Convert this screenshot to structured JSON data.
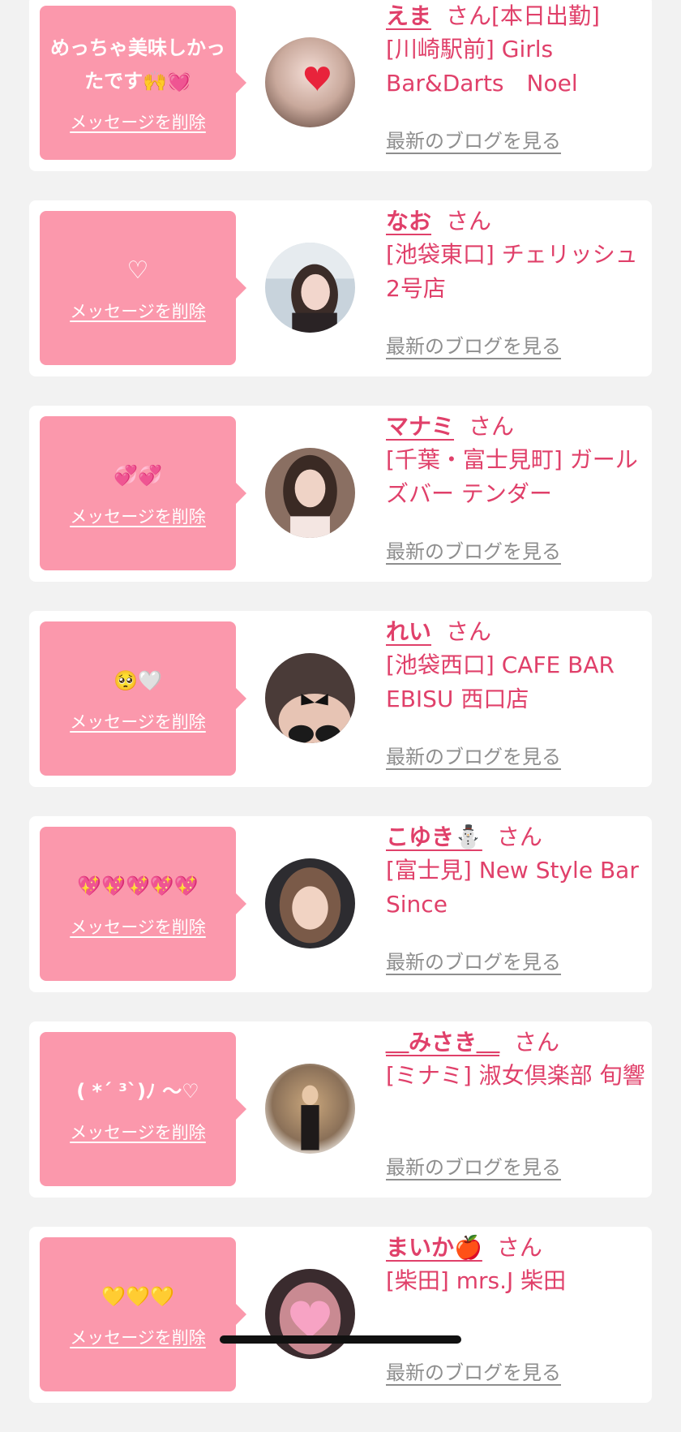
{
  "delete_label": "メッセージを削除",
  "blog_label": "最新のブログを見る",
  "san_label": "さん",
  "colors": {
    "background": "#f2f2f2",
    "bubble": "#fb98ac",
    "accent_text": "#e0406a",
    "link_gray": "#8e8e8e"
  },
  "cards": [
    {
      "message": "めっちゃ美味しかったです🙌💓",
      "name": "えま",
      "suffix": "さん[本日出勤]",
      "shop": "[川崎駅前] Girls Bar&Darts　Noel",
      "avatar_icon": "avatar-ema"
    },
    {
      "message": "♡",
      "name": "なお",
      "suffix": "さん",
      "shop": "[池袋東口] チェリッシュ2号店",
      "avatar_icon": "avatar-nao"
    },
    {
      "message": "💞💞",
      "name": "マナミ",
      "suffix": "さん",
      "shop": "[千葉・富士見町] ガールズバー テンダー",
      "avatar_icon": "avatar-manami"
    },
    {
      "message": "🥺🤍",
      "name": "れい",
      "suffix": "さん",
      "shop": "[池袋西口] CAFE BAR EBISU 西口店",
      "avatar_icon": "avatar-rei"
    },
    {
      "message": "💖💖💖💖💖",
      "name": "こゆき⛄️",
      "suffix": "さん",
      "shop": "[富士見] New Style Bar Since",
      "avatar_icon": "avatar-koyuki"
    },
    {
      "message": "( *´ ³`)ﾉ ～♡",
      "name": "＿みさき＿",
      "suffix": "さん",
      "shop": "[ミナミ] 淑女倶楽部 旬響",
      "avatar_icon": "avatar-misaki"
    },
    {
      "message": "💛💛💛",
      "name": "まいか🍎",
      "suffix": "さん",
      "shop": "[柴田] mrs.J 柴田",
      "avatar_icon": "avatar-maika"
    }
  ]
}
